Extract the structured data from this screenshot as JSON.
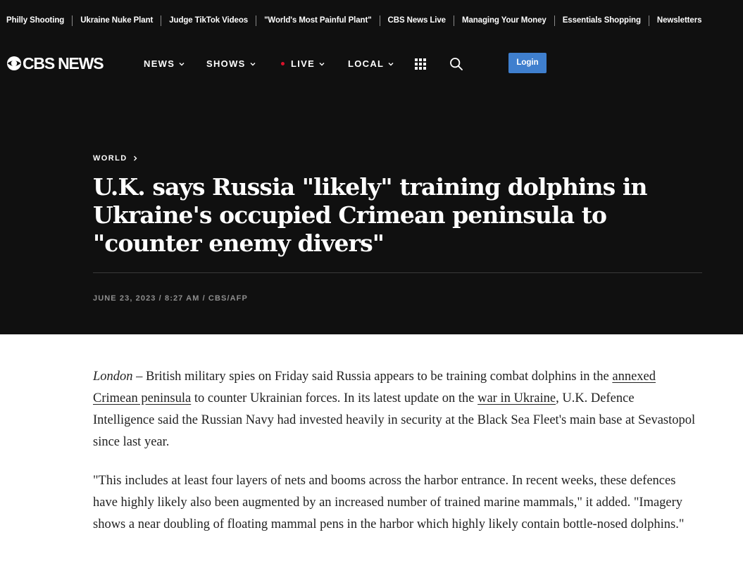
{
  "trending": {
    "items": [
      "Philly Shooting",
      "Ukraine Nuke Plant",
      "Judge TikTok Videos",
      "\"World's Most Painful Plant\"",
      "CBS News Live",
      "Managing Your Money",
      "Essentials Shopping",
      "Newsletters"
    ]
  },
  "header": {
    "logo_text": "CBS NEWS",
    "nav": {
      "news": "NEWS",
      "shows": "SHOWS",
      "live": "LIVE",
      "local": "LOCAL"
    },
    "login_label": "Login",
    "icons": {
      "grid": "grid-menu-icon",
      "search": "search-icon",
      "chevron": "chevron-down-icon"
    },
    "colors": {
      "background": "#101010",
      "live_dot": "#d9122b",
      "login_button": "#3f7fce"
    }
  },
  "hero": {
    "section": "WORLD",
    "headline": "U.K. says Russia \"likely\" training dolphins in Ukraine's occupied Crimean peninsula to \"counter enemy divers\"",
    "byline": "JUNE 23, 2023 / 8:27 AM / CBS/AFP"
  },
  "article": {
    "p1": {
      "dateline": "London",
      "text_a": " – British military spies on Friday said Russia appears to be training combat dolphins in the ",
      "link_1": "annexed Crimean peninsula",
      "text_b": " to counter Ukrainian forces. In its latest update on the ",
      "link_2": "war in Ukraine",
      "text_c": ", U.K. Defence Intelligence said the Russian Navy had invested heavily in security at the Black Sea Fleet's main base at Sevastopol since last year."
    },
    "p2": "\"This includes at least four layers of nets and booms across the harbor entrance. In recent weeks, these defences have highly likely also been augmented by an increased number of trained marine mammals,\" it added. \"Imagery shows a near doubling of floating mammal pens in the harbor which highly likely contain bottle-nosed dolphins.\""
  }
}
